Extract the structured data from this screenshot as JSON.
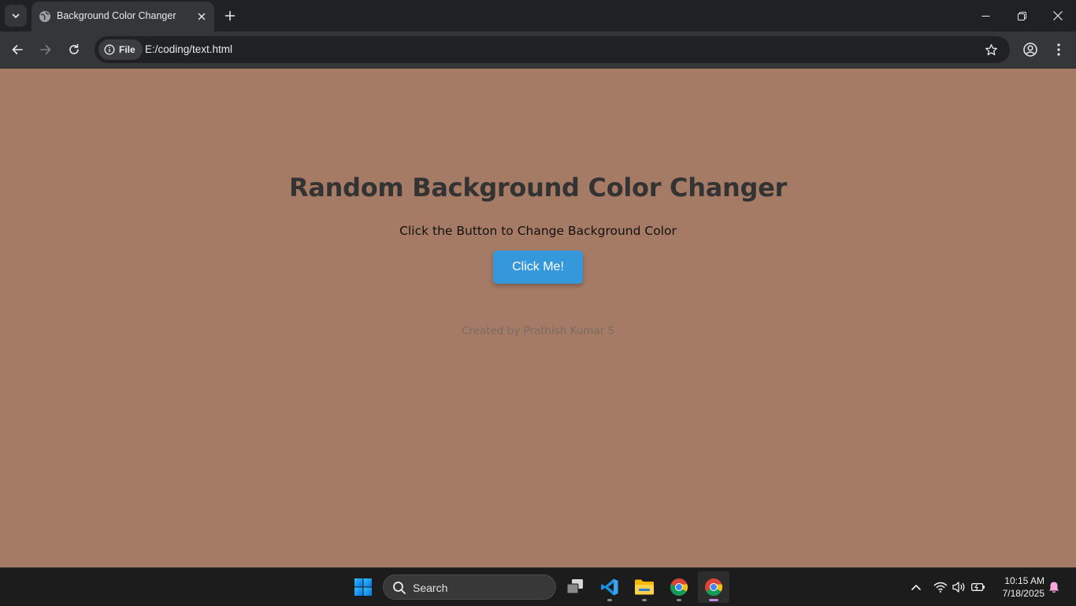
{
  "browser": {
    "tab_title": "Background Color Changer",
    "site_info_label": "File",
    "url": "E:/coding/text.html"
  },
  "page": {
    "heading": "Random Background Color Changer",
    "subheading": "Click the Button to Change Background Color",
    "button_label": "Click Me!",
    "footer": "Created by Prathish Kumar S",
    "background_color": "#a67b65",
    "button_color": "#3498db"
  },
  "taskbar": {
    "search_placeholder": "Search",
    "apps": [
      "start-icon",
      "task-view-icon",
      "vscode-icon",
      "file-explorer-icon",
      "chrome-icon",
      "chrome-icon"
    ],
    "time": "10:15 AM",
    "date": "7/18/2025"
  }
}
